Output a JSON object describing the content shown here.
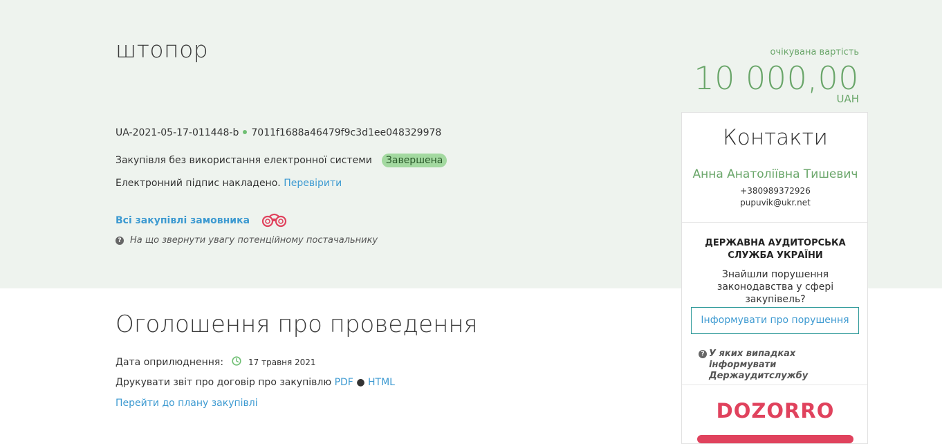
{
  "tender": {
    "title": "штопор",
    "tender_id": "UA-2021-05-17-011448-b",
    "hash": "7011f1688a46479f9c3d1ee048329978",
    "procedure": "Закупівля без використання електронної системи",
    "status": "Завершена",
    "signature_text": "Електронний підпис накладено.",
    "signature_link": "Перевірити",
    "all_purchases": "Всі закупівлі замовника",
    "attention_text": "На що звернути увагу потенційному постачальнику"
  },
  "expected": {
    "label": "очікувана вартість",
    "value": "10 000,00",
    "currency": "UAH"
  },
  "contacts": {
    "title": "Контакти",
    "name": "Анна Анатоліївна Тишевич",
    "phone": "+380989372926",
    "email": "pupuvik@ukr.net"
  },
  "audit": {
    "title": "ДЕРЖАВНА АУДИТОРСЬКА СЛУЖБА УКРАЇНИ",
    "question": "Знайшли порушення законодавства у сфері закупівель?",
    "button": "Інформувати про порушення",
    "help": "У яких випадках інформувати Держаудитслужбу"
  },
  "dozorro": {
    "logo": "DOZORRO"
  },
  "announcement": {
    "title": "Оголошення про проведення",
    "pub_label": "Дата оприлюднення:",
    "pub_date": "17 травня 2021",
    "print_text": "Друкувати звіт про договір про закупівлю",
    "pdf": "PDF",
    "html": "HTML",
    "plan_link": "Перейти до плану закупівлі"
  },
  "colors": {
    "hero_bg": "#eef3ee",
    "accent_green": "#6aa66a",
    "link_blue": "#3d9ad1",
    "dozorro_red": "#e0425d"
  }
}
